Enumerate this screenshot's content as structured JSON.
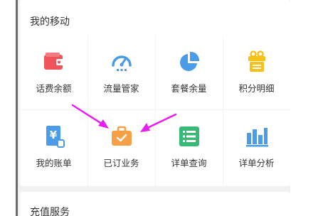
{
  "section_my_mobile": {
    "title": "我的移动",
    "items": [
      {
        "label": "话费余额",
        "icon": "wallet-icon",
        "color": "#f0545a"
      },
      {
        "label": "流量管家",
        "icon": "speedometer-icon",
        "color": "#4a9be8"
      },
      {
        "label": "套餐余量",
        "icon": "pie-chart-icon",
        "color": "#4a9be8"
      },
      {
        "label": "积分明细",
        "icon": "gift-icon",
        "color": "#f6c21a"
      },
      {
        "label": "我的账单",
        "icon": "bill-icon",
        "color": "#4a9be8"
      },
      {
        "label": "已订业务",
        "icon": "briefcase-check-icon",
        "color": "#f5a046"
      },
      {
        "label": "详单查询",
        "icon": "list-icon",
        "color": "#39b876"
      },
      {
        "label": "详单分析",
        "icon": "bar-chart-icon",
        "color": "#4a9be8"
      }
    ]
  },
  "section_recharge": {
    "title": "充值服务"
  },
  "annotation": {
    "arrow_color": "#e81cf0"
  }
}
